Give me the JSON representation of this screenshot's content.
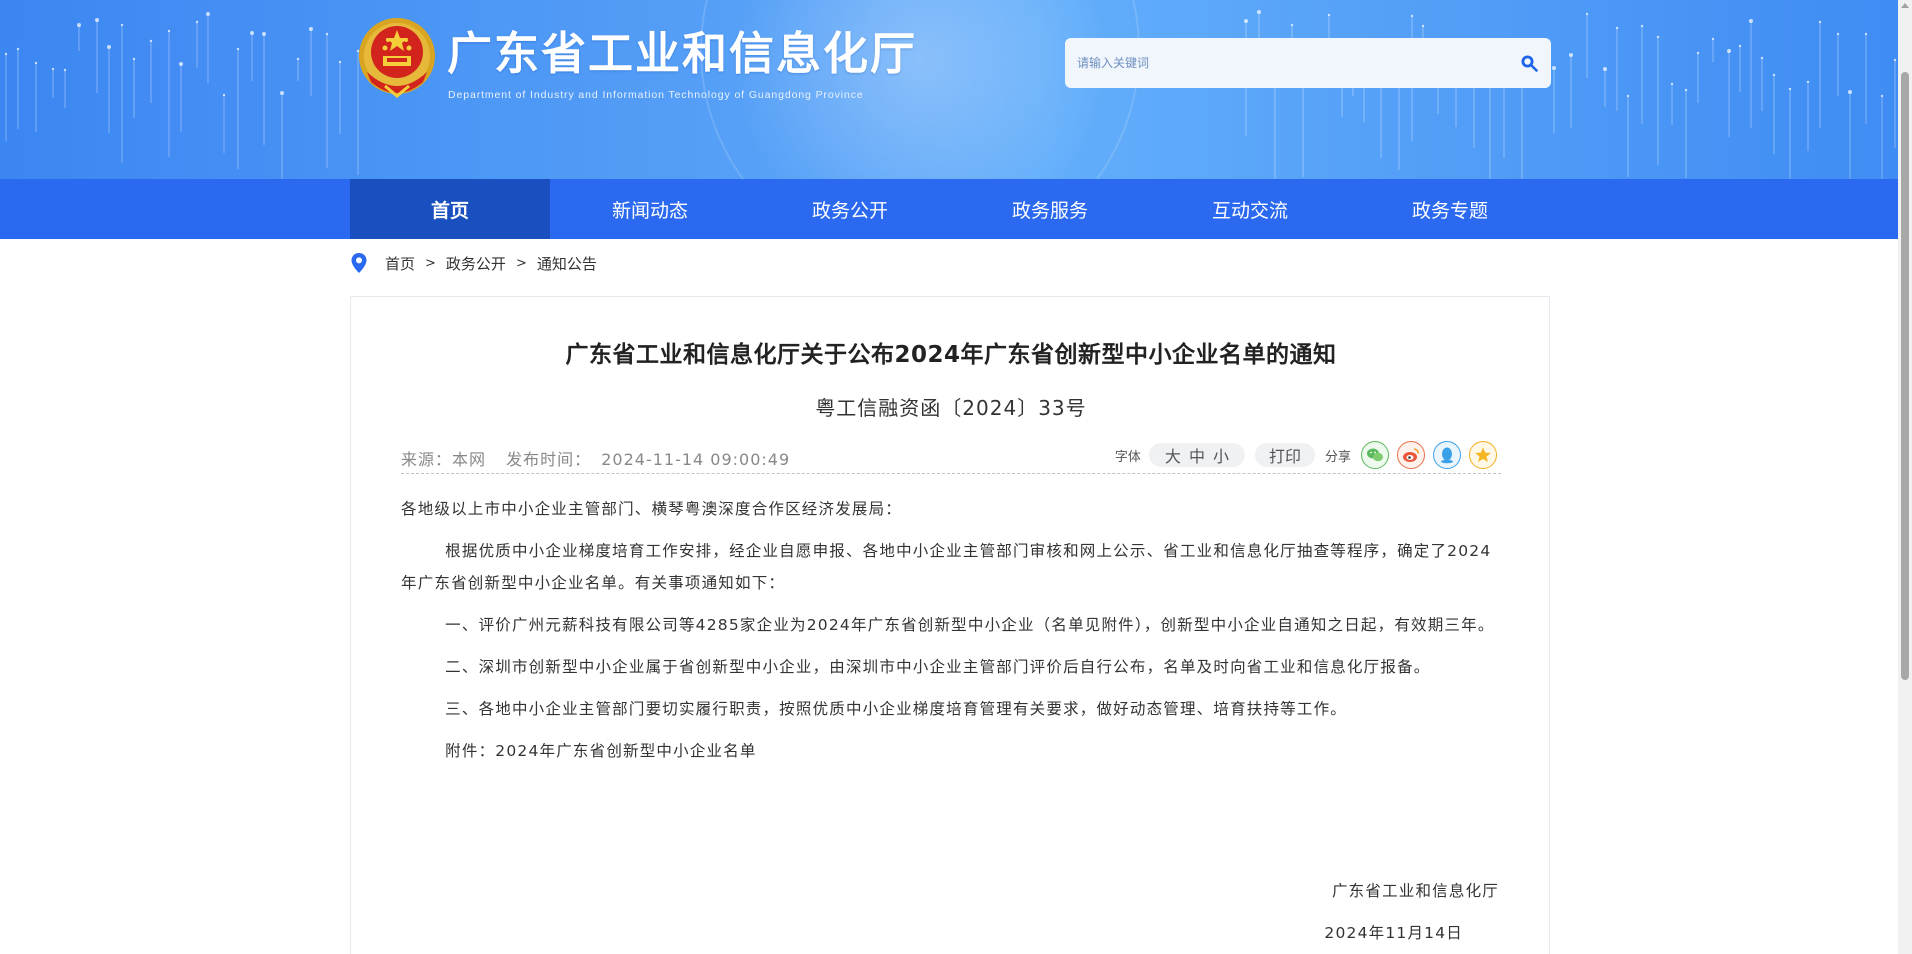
{
  "header": {
    "site_title": "广东省工业和信息化厅",
    "site_subtitle": "Department of Industry and Information Technology of Guangdong Province",
    "search_placeholder": "请输入关键词",
    "brand_color": "#2b6af0"
  },
  "nav": {
    "items": [
      {
        "label": "首页",
        "active": true
      },
      {
        "label": "新闻动态",
        "active": false
      },
      {
        "label": "政务公开",
        "active": false
      },
      {
        "label": "政务服务",
        "active": false
      },
      {
        "label": "互动交流",
        "active": false
      },
      {
        "label": "政务专题",
        "active": false
      }
    ]
  },
  "breadcrumb": {
    "items": [
      "首页",
      "政务公开",
      "通知公告"
    ],
    "separator": ">"
  },
  "article": {
    "title": "广东省工业和信息化厅关于公布2024年广东省创新型中小企业名单的通知",
    "doc_number": "粤工信融资函〔2024〕33号",
    "source_label": "来源：本网",
    "publish_time_label": "发布时间：",
    "publish_time": "2024-11-14 09:00:49",
    "font_label": "字体",
    "font_sizes": [
      "大",
      "中",
      "小"
    ],
    "print_label": "打印",
    "share_label": "分享",
    "share_icons": [
      "wechat-icon",
      "weibo-icon",
      "qq-icon",
      "qzone-icon"
    ],
    "paragraphs": [
      "各地级以上市中小企业主管部门、横琴粤澳深度合作区经济发展局：",
      "根据优质中小企业梯度培育工作安排，经企业自愿申报、各地中小企业主管部门审核和网上公示、省工业和信息化厅抽查等程序，确定了2024年广东省创新型中小企业名单。有关事项通知如下：",
      "一、评价广州元薪科技有限公司等4285家企业为2024年广东省创新型中小企业（名单见附件），创新型中小企业自通知之日起，有效期三年。",
      "二、深圳市创新型中小企业属于省创新型中小企业，由深圳市中小企业主管部门评价后自行公布，名单及时向省工业和信息化厅报备。",
      "三、各地中小企业主管部门要切实履行职责，按照优质中小企业梯度培育管理有关要求，做好动态管理、培育扶持等工作。",
      "附件：2024年广东省创新型中小企业名单"
    ],
    "sign_org": "广东省工业和信息化厅",
    "sign_date": "2024年11月14日"
  }
}
